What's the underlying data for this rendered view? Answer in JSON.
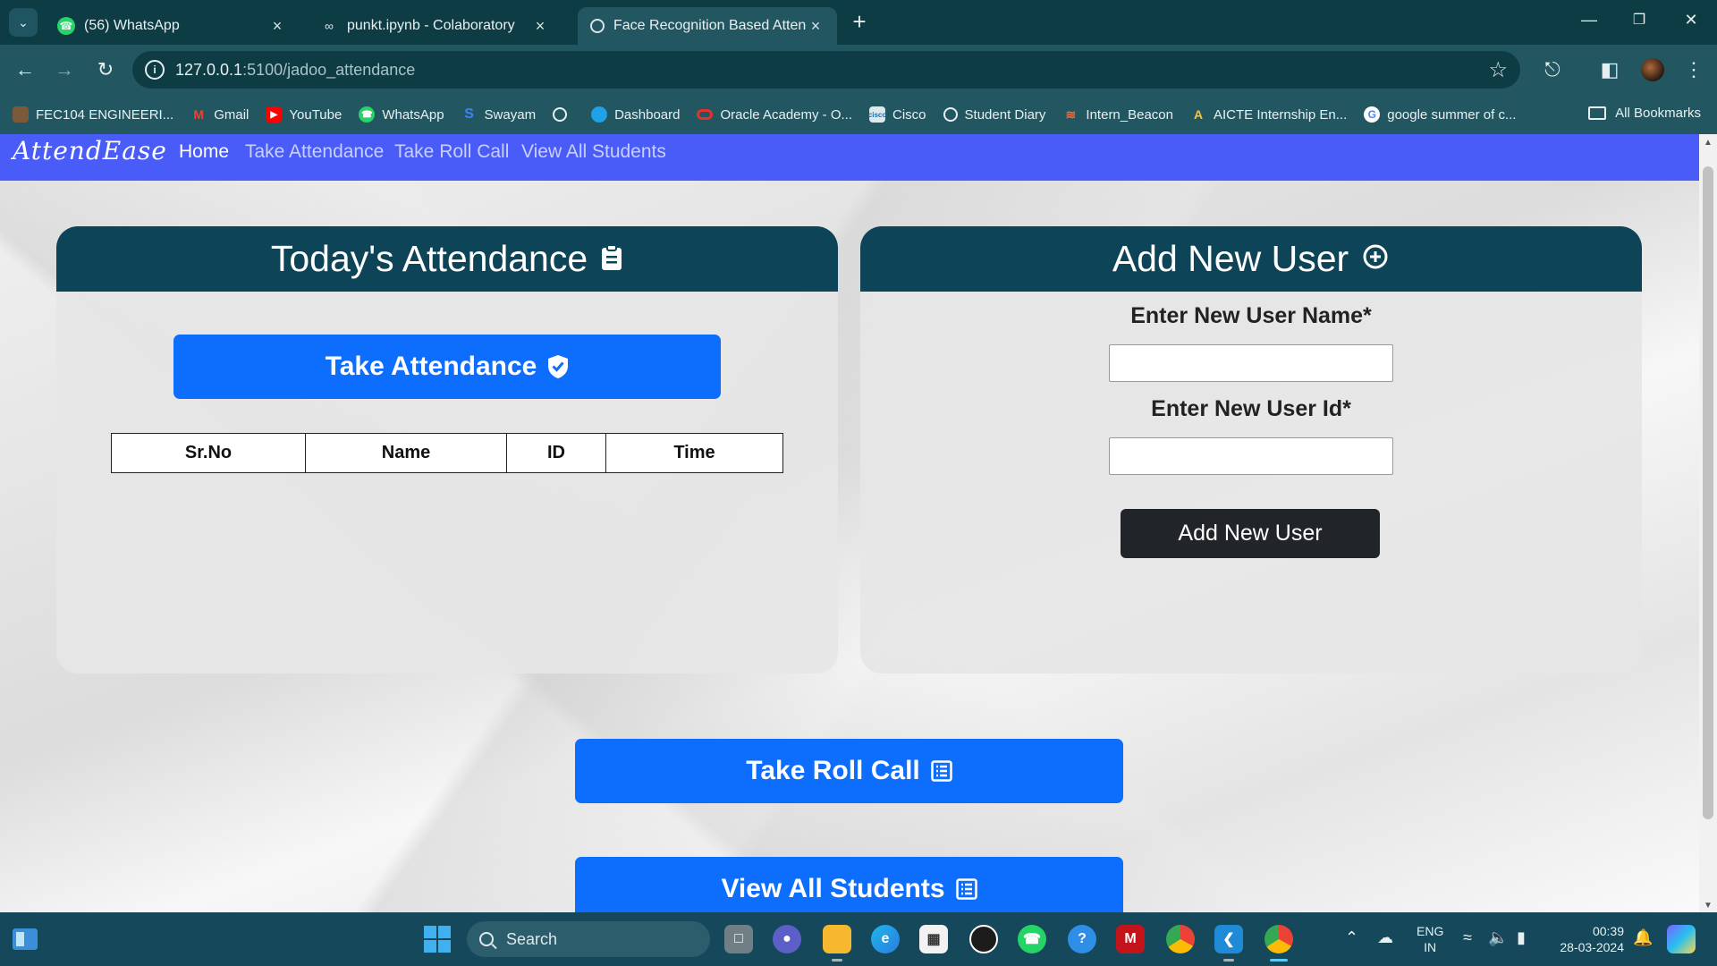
{
  "browser": {
    "tabs": [
      {
        "title": "(56) WhatsApp",
        "icon": "whatsapp-icon",
        "active": false
      },
      {
        "title": "punkt.ipynb - Colaboratory",
        "icon": "colab-icon",
        "active": false
      },
      {
        "title": "Face Recognition Based Attenda",
        "icon": "globe-icon",
        "active": true
      }
    ],
    "url_host": "127.0.0.1",
    "url_rest": ":5100/jadoo_attendance",
    "bookmarks": [
      "FEC104 ENGINEERI...",
      "Gmail",
      "YouTube",
      "WhatsApp",
      "Swayam",
      "",
      "Dashboard",
      "Oracle Academy - O...",
      "Cisco",
      "Student Diary",
      "Intern_Beacon",
      "AICTE Internship En...",
      "google summer of c..."
    ],
    "all_bookmarks": "All Bookmarks"
  },
  "app": {
    "brand": "AttendEase",
    "nav": [
      "Home",
      "Take Attendance",
      "Take Roll Call",
      "View All Students"
    ],
    "attendance_card": {
      "title": "Today's Attendance",
      "take_button": "Take Attendance",
      "table_headers": [
        "Sr.No",
        "Name",
        "ID",
        "Time"
      ],
      "rows": []
    },
    "add_user_card": {
      "title": "Add New User",
      "name_label": "Enter New User Name*",
      "name_value": "",
      "id_label": "Enter New User Id*",
      "id_value": "",
      "submit": "Add New User"
    },
    "roll_call_button": "Take Roll Call",
    "view_students_button": "View All Students"
  },
  "taskbar": {
    "search_placeholder": "Search",
    "lang_line1": "ENG",
    "lang_line2": "IN",
    "time": "00:39",
    "date": "28-03-2024"
  },
  "colors": {
    "navbar": "#4a5cf7",
    "card_header": "#0e4458",
    "primary_button": "#0d6efd",
    "dark_button": "#212529",
    "browser_chrome": "#225761"
  }
}
